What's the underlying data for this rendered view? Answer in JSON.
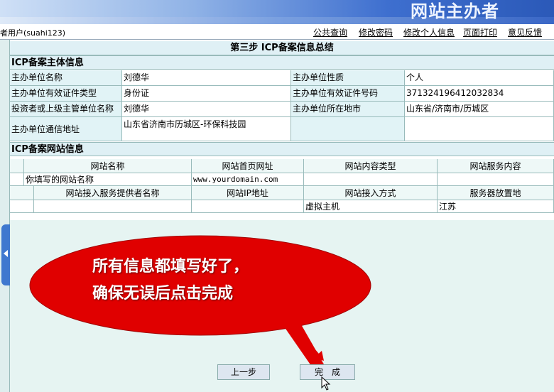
{
  "banner": {
    "title": "网站主办者"
  },
  "nav": {
    "user": "者用户(suahi123)",
    "links": [
      "公共查询",
      "修改密码",
      "修改个人信息",
      "页面打印",
      "意见反馈"
    ]
  },
  "page": {
    "step_title": "第三步  ICP备案信息总结"
  },
  "subject": {
    "heading": "ICP备案主体信息",
    "rows": [
      {
        "label1": "主办单位名称",
        "value1": "刘德华",
        "label2": "主办单位性质",
        "value2": "个人"
      },
      {
        "label1": "主办单位有效证件类型",
        "value1": "身份证",
        "label2": "主办单位有效证件号码",
        "value2": "371324196412032834"
      },
      {
        "label1": "投资者或上级主管单位名称",
        "value1": "刘德华",
        "label2": "主办单位所在地市",
        "value2": "山东省/济南市/历城区"
      },
      {
        "label1": "主办单位通信地址",
        "value1": "山东省济南市历城区-环保科技园",
        "label2": "",
        "value2": ""
      }
    ]
  },
  "website": {
    "heading": "ICP备案网站信息",
    "columns1": [
      "网站名称",
      "网站首页网址",
      "网站内容类型",
      "网站服务内容"
    ],
    "row1": [
      "你填写的网站名称",
      "www.yourdomain.com",
      "",
      ""
    ],
    "columns2": [
      "网站接入服务提供者名称",
      "网站IP地址",
      "网站接入方式",
      "服务器放置地"
    ],
    "row2": [
      "",
      "",
      "虚拟主机",
      "江苏"
    ]
  },
  "callout": {
    "line1": "所有信息都填写好了，",
    "line2": "确保无误后点击完成"
  },
  "buttons": {
    "prev": "上一步",
    "finish": "完　成"
  },
  "colors": {
    "callout_red": "#e00000",
    "arrow_red": "#e00000"
  }
}
